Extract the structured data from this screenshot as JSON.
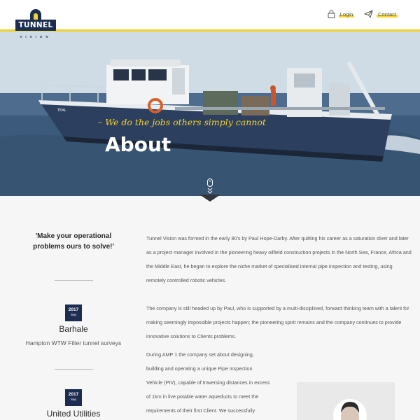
{
  "header": {
    "logo_text": "TUNNEL",
    "logo_subtext": "VISION",
    "nav": [
      {
        "label": "Login",
        "icon": "lock-icon"
      },
      {
        "label": "Contact",
        "icon": "paper-plane-icon"
      }
    ],
    "accent_color": "#f3d22a",
    "brand_color": "#1d2d52"
  },
  "hero": {
    "tagline": "– We do the jobs others simply cannot",
    "title": "About",
    "boat_name": "TEAL",
    "scroll_icons": [
      "mouse-icon",
      "chevron-double-down-icon"
    ]
  },
  "sidebar": {
    "quote": "'Make your operational problems ours to solve!'",
    "news": [
      {
        "year": "2017",
        "month": "Sep",
        "title": "Barhale",
        "description": "Hampton WTW Filter tunnel surveys"
      },
      {
        "year": "2017",
        "month": "Sep",
        "title": "United Utilities",
        "description": ""
      }
    ]
  },
  "content": {
    "paragraphs": [
      "Tunnel Vision was formed in the early 80's by Paul Hope-Darby. After quitting his career as a saturation diver and later as a project manager involved in the pioneering heavy oilfield construction projects in the North Sea, France, Africa and the Middle East, he began to explore the niche market of specialised internal pipe inspection and testing, using remotely controlled robotic vehicles.",
      "The company is still headed up by Paul, who is supported by a multi-disciplined, forward thinking team with a talent for making seemingly impossible projects happen; the pioneering spirit remains and the company continues to provide innovative solutions to Clients problems."
    ],
    "narrow_lines": [
      "During AMP 1 the company set about designing,",
      "building and operating a unique Pipe Inspection",
      "Vehicle (PIV), capable of traversing distances in excess",
      "of 1km in live potable water aqueducts to meet the",
      "requirements of their first Client. We successfully"
    ]
  }
}
